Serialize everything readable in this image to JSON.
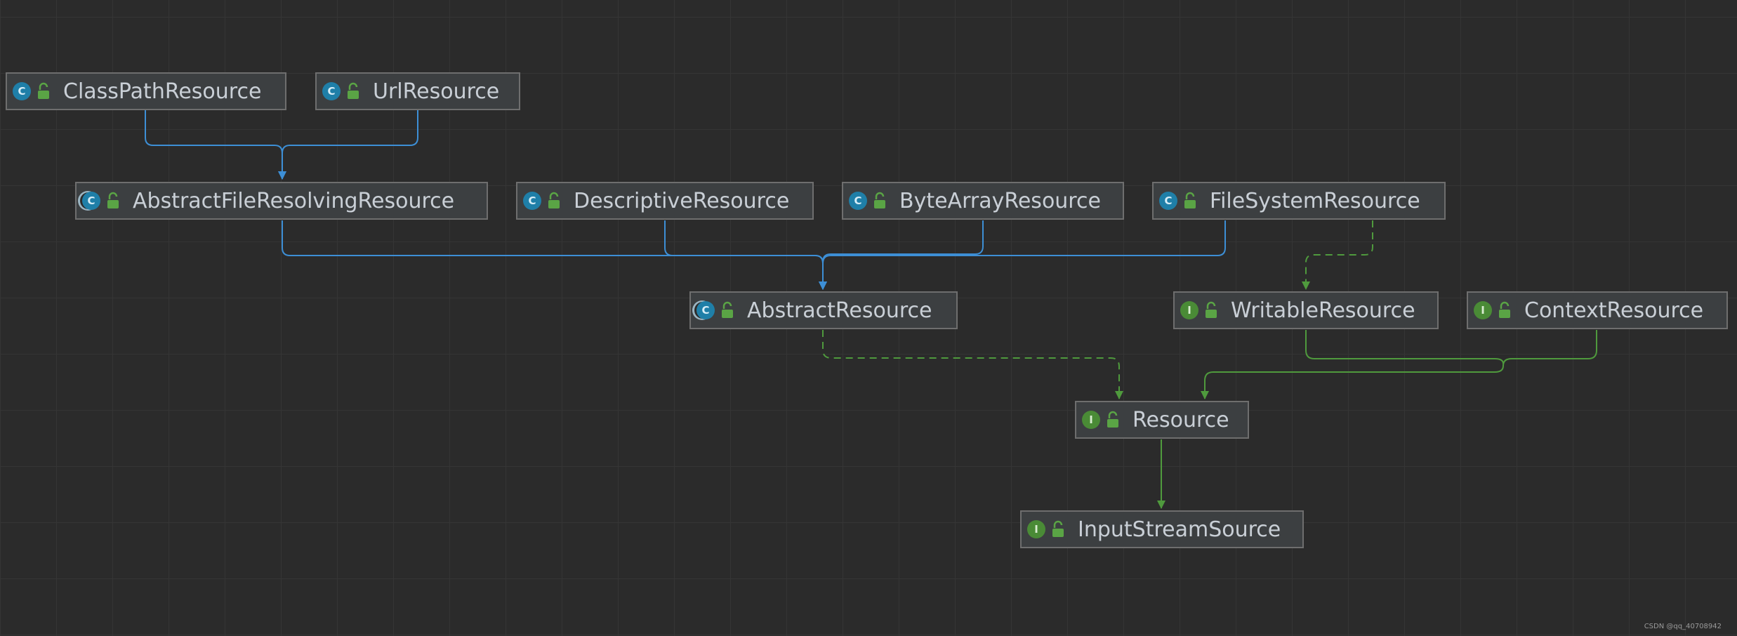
{
  "diagram": {
    "nodes": [
      {
        "id": "classpath",
        "label": "ClassPathResource",
        "kind": "class",
        "kind_letter": "C"
      },
      {
        "id": "url",
        "label": "UrlResource",
        "kind": "class",
        "kind_letter": "C"
      },
      {
        "id": "abstract_file_resolving",
        "label": "AbstractFileResolvingResource",
        "kind": "abstract class",
        "kind_letter": "C"
      },
      {
        "id": "descriptive",
        "label": "DescriptiveResource",
        "kind": "class",
        "kind_letter": "C"
      },
      {
        "id": "byte_array",
        "label": "ByteArrayResource",
        "kind": "class",
        "kind_letter": "C"
      },
      {
        "id": "file_system",
        "label": "FileSystemResource",
        "kind": "class",
        "kind_letter": "C"
      },
      {
        "id": "abstract_resource",
        "label": "AbstractResource",
        "kind": "abstract class",
        "kind_letter": "C"
      },
      {
        "id": "writable",
        "label": "WritableResource",
        "kind": "interface",
        "kind_letter": "I"
      },
      {
        "id": "context",
        "label": "ContextResource",
        "kind": "interface",
        "kind_letter": "I"
      },
      {
        "id": "resource",
        "label": "Resource",
        "kind": "interface",
        "kind_letter": "I"
      },
      {
        "id": "input_stream_source",
        "label": "InputStreamSource",
        "kind": "interface",
        "kind_letter": "I"
      }
    ],
    "edges": [
      {
        "from": "classpath",
        "to": "abstract_file_resolving",
        "type": "extends"
      },
      {
        "from": "url",
        "to": "abstract_file_resolving",
        "type": "extends"
      },
      {
        "from": "abstract_file_resolving",
        "to": "abstract_resource",
        "type": "extends"
      },
      {
        "from": "descriptive",
        "to": "abstract_resource",
        "type": "extends"
      },
      {
        "from": "byte_array",
        "to": "abstract_resource",
        "type": "extends"
      },
      {
        "from": "file_system",
        "to": "abstract_resource",
        "type": "extends"
      },
      {
        "from": "file_system",
        "to": "writable",
        "type": "implements"
      },
      {
        "from": "abstract_resource",
        "to": "resource",
        "type": "implements"
      },
      {
        "from": "writable",
        "to": "resource",
        "type": "extends-interface"
      },
      {
        "from": "context",
        "to": "resource",
        "type": "extends-interface"
      },
      {
        "from": "resource",
        "to": "input_stream_source",
        "type": "extends-interface"
      }
    ],
    "colors": {
      "background": "#2b2b2b",
      "grid": "#353535",
      "node_fill": "#3c3f41",
      "node_border": "#6e6e6e",
      "node_text": "#c9cfd6",
      "class_edge": "#3d8fd6",
      "interface_edge": "#4f9a3d",
      "class_icon": "#1f7fa8",
      "interface_icon": "#4a8b36",
      "lock_icon": "#5aa445"
    }
  },
  "watermark": "CSDN @qq_40708942"
}
